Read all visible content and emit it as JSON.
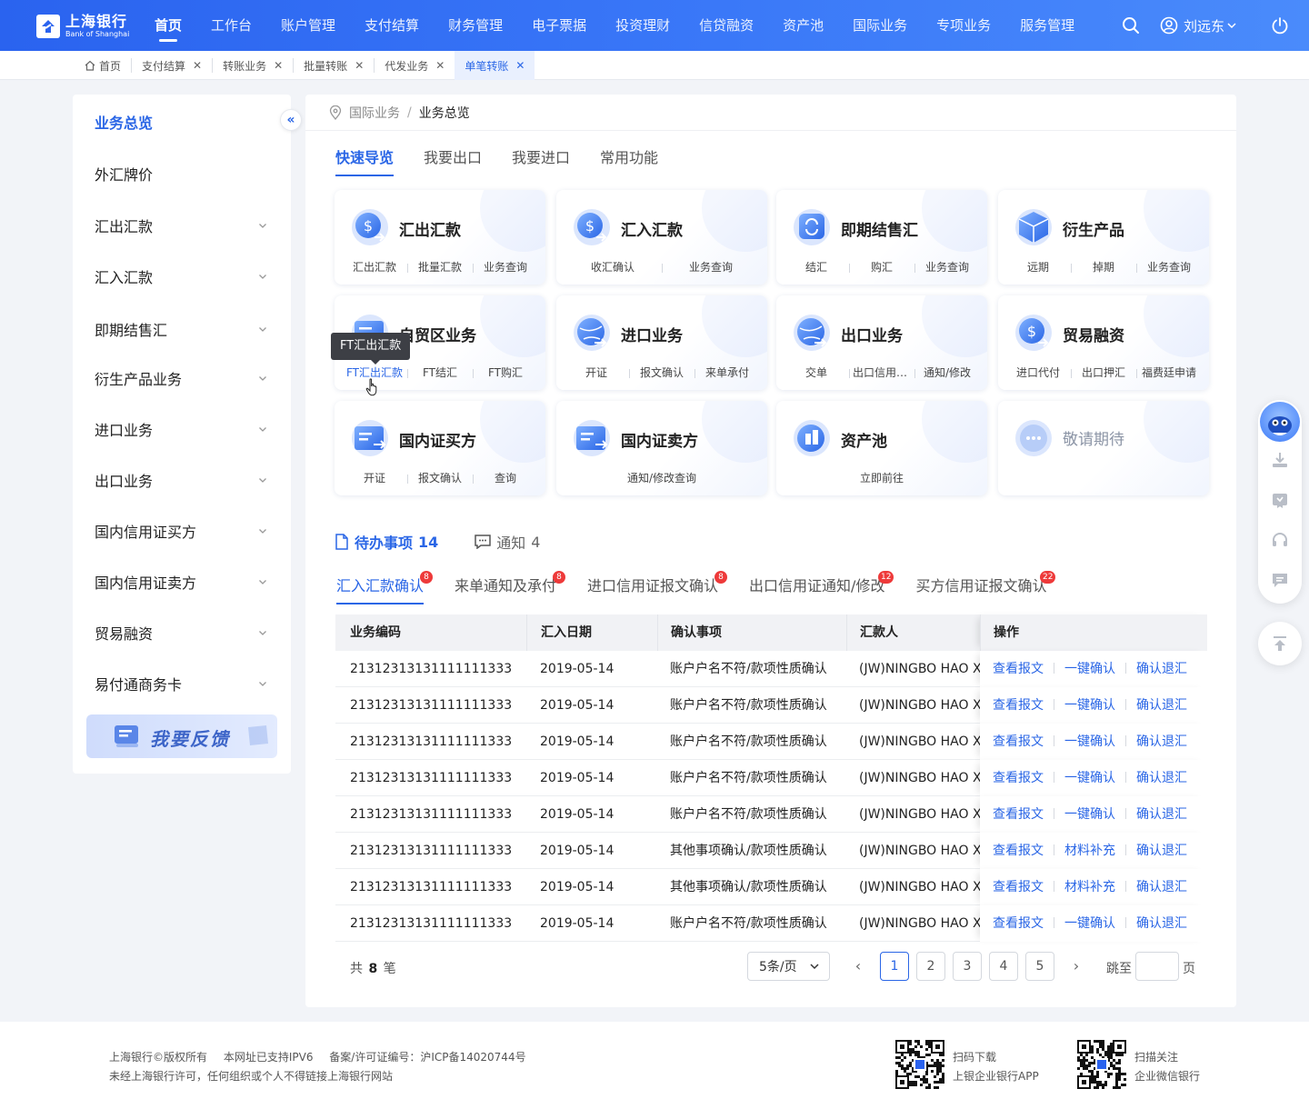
{
  "brand": {
    "name_cn": "上海银行",
    "name_en": "Bank of Shanghai",
    "primary": "#2a63ef"
  },
  "nav": {
    "items": [
      "首页",
      "工作台",
      "账户管理",
      "支付结算",
      "财务管理",
      "电子票据",
      "投资理财",
      "信贷融资",
      "资产池",
      "国际业务",
      "专项业务",
      "服务管理"
    ],
    "active": "首页",
    "user": "刘远东"
  },
  "page_tabs": [
    {
      "label": "首页",
      "icon": "home-icon"
    },
    {
      "label": "支付结算",
      "closable": true
    },
    {
      "label": "转账业务",
      "closable": true
    },
    {
      "label": "批量转账",
      "closable": true
    },
    {
      "label": "代发业务",
      "closable": true
    },
    {
      "label": "单笔转账",
      "closable": true,
      "active": true
    }
  ],
  "sidebar": {
    "items": [
      {
        "label": "业务总览",
        "active": true
      },
      {
        "label": "外汇牌价"
      },
      {
        "label": "汇出汇款",
        "expandable": true
      },
      {
        "label": "汇入汇款",
        "expandable": true
      },
      {
        "label": "即期结售汇",
        "expandable": true
      },
      {
        "label": "衍生产品业务",
        "expandable": true
      },
      {
        "label": "进口业务",
        "expandable": true
      },
      {
        "label": "出口业务",
        "expandable": true
      },
      {
        "label": "国内信用证买方",
        "expandable": true
      },
      {
        "label": "国内信用证卖方",
        "expandable": true
      },
      {
        "label": "贸易融资",
        "expandable": true
      },
      {
        "label": "易付通商务卡",
        "expandable": true
      }
    ],
    "feedback": "我要反馈"
  },
  "breadcrumb": {
    "parent": "国际业务",
    "separator": "/",
    "current": "业务总览"
  },
  "quick_tabs": {
    "items": [
      "快速导览",
      "我要出口",
      "我要进口",
      "常用功能"
    ],
    "active": "快速导览"
  },
  "cards": [
    {
      "title": "汇出汇款",
      "icon": "remit-out-icon",
      "links": [
        "汇出汇款",
        "批量汇款",
        "业务查询"
      ]
    },
    {
      "title": "汇入汇款",
      "icon": "remit-in-icon",
      "links": [
        "收汇确认",
        "业务查询"
      ]
    },
    {
      "title": "即期结售汇",
      "icon": "exchange-icon",
      "links": [
        "结汇",
        "购汇",
        "业务查询"
      ]
    },
    {
      "title": "衍生产品",
      "icon": "cube-icon",
      "links": [
        "远期",
        "掉期",
        "业务查询"
      ]
    },
    {
      "title": "自贸区业务",
      "icon": "ftz-icon",
      "links": [
        "FT汇出汇款",
        "FT结汇",
        "FT购汇"
      ]
    },
    {
      "title": "进口业务",
      "icon": "import-globe-icon",
      "links": [
        "开证",
        "报文确认",
        "来单承付"
      ]
    },
    {
      "title": "出口业务",
      "icon": "export-globe-icon",
      "links": [
        "交单",
        "出口信用证通知",
        "通知/修改"
      ]
    },
    {
      "title": "贸易融资",
      "icon": "dollar-coin-icon",
      "links": [
        "进口代付",
        "出口押汇",
        "福费廷申请"
      ]
    },
    {
      "title": "国内证买方",
      "icon": "lc-buyer-icon",
      "links": [
        "开证",
        "报文确认",
        "查询"
      ]
    },
    {
      "title": "国内证卖方",
      "icon": "lc-seller-icon",
      "links": [
        "通知/修改查询"
      ]
    },
    {
      "title": "资产池",
      "icon": "asset-pool-icon",
      "links": [
        "立即前往"
      ]
    },
    {
      "title": "敬请期待",
      "icon": "more-icon",
      "links": [],
      "disabled": true
    }
  ],
  "tooltip": {
    "text": "FT汇出汇款"
  },
  "todo": {
    "tabs": [
      {
        "label": "待办事项",
        "count": "14",
        "active": true
      },
      {
        "label": "通知",
        "count": "4"
      }
    ],
    "sub_tabs": [
      {
        "label": "汇入汇款确认",
        "badge": "8",
        "active": true
      },
      {
        "label": "来单通知及承付",
        "badge": "8"
      },
      {
        "label": "进口信用证报文确认",
        "badge": "8"
      },
      {
        "label": "出口信用证通知/修改",
        "badge": "12"
      },
      {
        "label": "买方信用证报文确认",
        "badge": "22"
      }
    ]
  },
  "table": {
    "columns": [
      "业务编码",
      "汇入日期",
      "确认事项",
      "汇款人",
      "操作"
    ],
    "rows": [
      {
        "code": "21312313131111111333",
        "date": "2019-05-14",
        "item": "账户户名不符/款项性质确认",
        "payer": "(JW)NINGBO HAO XI",
        "ops": [
          "查看报文",
          "一键确认",
          "确认退汇"
        ]
      },
      {
        "code": "21312313131111111333",
        "date": "2019-05-14",
        "item": "账户户名不符/款项性质确认",
        "payer": "(JW)NINGBO HAO XI",
        "ops": [
          "查看报文",
          "一键确认",
          "确认退汇"
        ]
      },
      {
        "code": "21312313131111111333",
        "date": "2019-05-14",
        "item": "账户户名不符/款项性质确认",
        "payer": "(JW)NINGBO HAO XI",
        "ops": [
          "查看报文",
          "一键确认",
          "确认退汇"
        ]
      },
      {
        "code": "21312313131111111333",
        "date": "2019-05-14",
        "item": "账户户名不符/款项性质确认",
        "payer": "(JW)NINGBO HAO XI",
        "ops": [
          "查看报文",
          "一键确认",
          "确认退汇"
        ]
      },
      {
        "code": "21312313131111111333",
        "date": "2019-05-14",
        "item": "账户户名不符/款项性质确认",
        "payer": "(JW)NINGBO HAO XI",
        "ops": [
          "查看报文",
          "一键确认",
          "确认退汇"
        ]
      },
      {
        "code": "21312313131111111333",
        "date": "2019-05-14",
        "item": "其他事项确认/款项性质确认",
        "payer": "(JW)NINGBO HAO XI",
        "ops": [
          "查看报文",
          "材料补充",
          "确认退汇"
        ]
      },
      {
        "code": "21312313131111111333",
        "date": "2019-05-14",
        "item": "其他事项确认/款项性质确认",
        "payer": "(JW)NINGBO HAO XI",
        "ops": [
          "查看报文",
          "材料补充",
          "确认退汇"
        ]
      },
      {
        "code": "21312313131111111333",
        "date": "2019-05-14",
        "item": "账户户名不符/款项性质确认",
        "payer": "(JW)NINGBO HAO XI",
        "ops": [
          "查看报文",
          "一键确认",
          "确认退汇"
        ]
      }
    ]
  },
  "pager": {
    "total_prefix": "共",
    "total": "8",
    "total_suffix": "笔",
    "page_size": "5条/页",
    "pages": [
      "1",
      "2",
      "3",
      "4",
      "5"
    ],
    "current": "1",
    "jump_label": "跳至",
    "jump_suffix": "页"
  },
  "footer": {
    "copyright": "上海银行©版权所有",
    "ipv6": "本网址已支持IPV6",
    "icp": "备案/许可证编号：沪ICP备14020744号",
    "notice": "未经上海银行许可，任何组织或个人不得链接上海银行网站",
    "qr1": {
      "line1": "扫码下载",
      "line2": "上银企业银行APP"
    },
    "qr2": {
      "line1": "扫描关注",
      "line2": "企业微信银行"
    }
  }
}
